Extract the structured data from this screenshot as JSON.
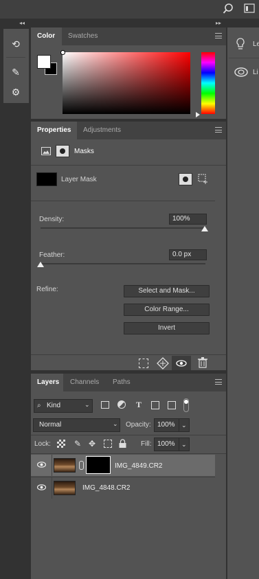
{
  "color_panel": {
    "tabs": [
      "Color",
      "Swatches"
    ]
  },
  "properties_panel": {
    "tabs": [
      "Properties",
      "Adjustments"
    ],
    "section_title": "Masks",
    "mask_label": "Layer Mask",
    "density_label": "Density:",
    "density_value": "100%",
    "feather_label": "Feather:",
    "feather_value": "0.0 px",
    "refine_label": "Refine:",
    "buttons": [
      "Select and Mask...",
      "Color Range...",
      "Invert"
    ]
  },
  "layers_panel": {
    "tabs": [
      "Layers",
      "Channels",
      "Paths"
    ],
    "filter_kind": "Kind",
    "blend_mode": "Normal",
    "opacity_label": "Opacity:",
    "opacity_value": "100%",
    "lock_label": "Lock:",
    "fill_label": "Fill:",
    "fill_value": "100%",
    "layers": [
      {
        "name": "IMG_4849.CR2",
        "selected": true
      },
      {
        "name": "IMG_4848.CR2",
        "selected": false
      }
    ]
  },
  "right_panel": {
    "items": [
      "Le",
      "Li"
    ]
  },
  "colors": {
    "hue_red": "#ff0000",
    "selected_layer": "#6b6b6b"
  }
}
